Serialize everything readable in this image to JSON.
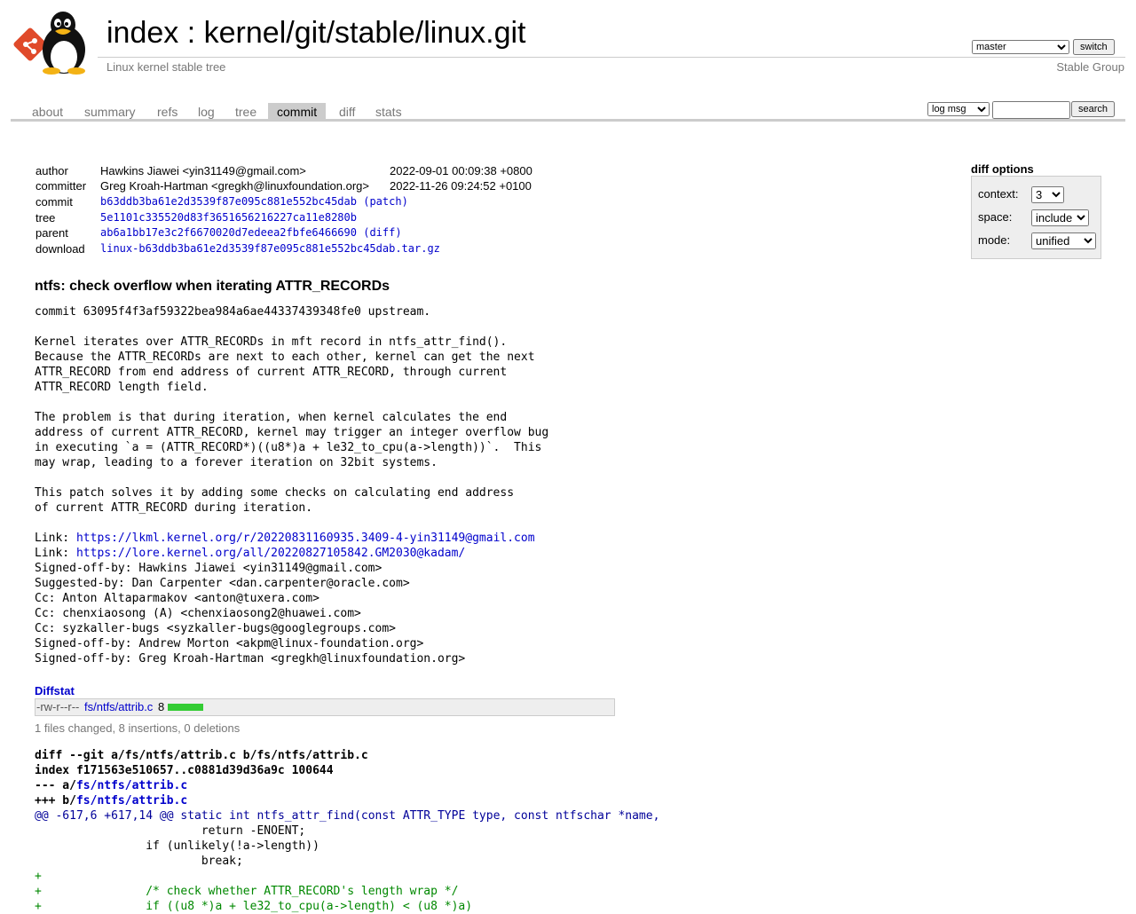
{
  "header": {
    "title_prefix": "index",
    "title_sep": ":",
    "repo_path": "kernel/git/stable/linux.git",
    "subtitle": "Linux kernel stable tree",
    "owner": "Stable Group",
    "branch_selected": "master",
    "switch_label": "switch"
  },
  "tabs": [
    "about",
    "summary",
    "refs",
    "log",
    "tree",
    "commit",
    "diff",
    "stats"
  ],
  "active_tab": "commit",
  "search": {
    "mode_selected": "log msg",
    "value": "",
    "button_label": "search"
  },
  "commit_info": {
    "author_label": "author",
    "author": "Hawkins Jiawei <yin31149@gmail.com>",
    "author_date": "2022-09-01 00:09:38 +0800",
    "committer_label": "committer",
    "committer": "Greg Kroah-Hartman <gregkh@linuxfoundation.org>",
    "committer_date": "2022-11-26 09:24:52 +0100",
    "commit_label": "commit",
    "commit_hash": "b63ddb3ba61e2d3539f87e095c881e552bc45dab",
    "commit_extra": "(patch)",
    "tree_label": "tree",
    "tree_hash": "5e1101c335520d83f3651656216227ca11e8280b",
    "parent_label": "parent",
    "parent_hash": "ab6a1bb17e3c2f6670020d7edeea2fbfe6466690",
    "parent_extra": "(diff)",
    "download_label": "download",
    "download": "linux-b63ddb3ba61e2d3539f87e095c881e552bc45dab.tar.gz"
  },
  "diff_options": {
    "title": "diff options",
    "context_label": "context:",
    "context_value": "3",
    "space_label": "space:",
    "space_value": "include",
    "mode_label": "mode:",
    "mode_value": "unified"
  },
  "message": {
    "subject": "ntfs: check overflow when iterating ATTR_RECORDs",
    "body_lines": [
      "commit 63095f4f3af59322bea984a6ae44337439348fe0 upstream.",
      "",
      "Kernel iterates over ATTR_RECORDs in mft record in ntfs_attr_find().",
      "Because the ATTR_RECORDs are next to each other, kernel can get the next",
      "ATTR_RECORD from end address of current ATTR_RECORD, through current",
      "ATTR_RECORD length field.",
      "",
      "The problem is that during iteration, when kernel calculates the end",
      "address of current ATTR_RECORD, kernel may trigger an integer overflow bug",
      "in executing `a = (ATTR_RECORD*)((u8*)a + le32_to_cpu(a->length))`.  This",
      "may wrap, leading to a forever iteration on 32bit systems.",
      "",
      "This patch solves it by adding some checks on calculating end address",
      "of current ATTR_RECORD during iteration.",
      ""
    ],
    "link1_prefix": "Link: ",
    "link1": "https://lkml.kernel.org/r/20220831160935.3409-4-yin31149@gmail.com",
    "link2_prefix": "Link: ",
    "link2": "https://lore.kernel.org/all/20220827105842.GM2030@kadam/",
    "trailer_lines": [
      "Signed-off-by: Hawkins Jiawei <yin31149@gmail.com>",
      "Suggested-by: Dan Carpenter <dan.carpenter@oracle.com>",
      "Cc: Anton Altaparmakov <anton@tuxera.com>",
      "Cc: chenxiaosong (A) <chenxiaosong2@huawei.com>",
      "Cc: syzkaller-bugs <syzkaller-bugs@googlegroups.com>",
      "Signed-off-by: Andrew Morton <akpm@linux-foundation.org>",
      "Signed-off-by: Greg Kroah-Hartman <gregkh@linuxfoundation.org>"
    ]
  },
  "diffstat": {
    "header": "Diffstat",
    "mode": "-rw-r--r--",
    "file": "fs/ntfs/attrib.c",
    "count": "8",
    "insert_fraction": 1.0,
    "summary": "1 files changed, 8 insertions, 0 deletions"
  },
  "diff": {
    "header1": "diff --git a/fs/ntfs/attrib.c b/fs/ntfs/attrib.c",
    "header2": "index f171563e510657..c0881d39d36a9c 100644",
    "old_prefix": "--- a/",
    "old_file": "fs/ntfs/attrib.c",
    "new_prefix": "+++ b/",
    "new_file": "fs/ntfs/attrib.c",
    "hunk_range": "@@ -617,6 +617,14 @@",
    "hunk_context": " static int ntfs_attr_find(const ATTR_TYPE type, const ntfschar *name,",
    "lines": [
      {
        "type": "ctx",
        "text": " \t\t\treturn -ENOENT;"
      },
      {
        "type": "ctx",
        "text": " \t\tif (unlikely(!a->length))"
      },
      {
        "type": "ctx",
        "text": " \t\t\tbreak;"
      },
      {
        "type": "add",
        "text": "+"
      },
      {
        "type": "add",
        "text": "+\t\t/* check whether ATTR_RECORD's length wrap */"
      },
      {
        "type": "add",
        "text": "+\t\tif ((u8 *)a + le32_to_cpu(a->length) < (u8 *)a)"
      }
    ]
  }
}
